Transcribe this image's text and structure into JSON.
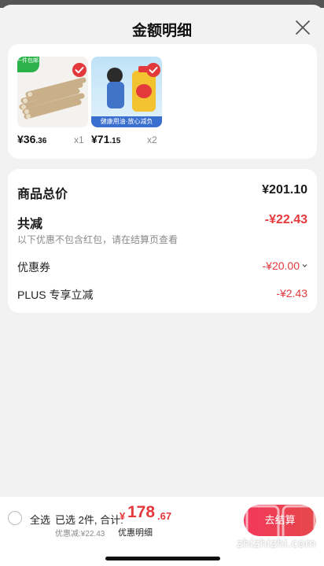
{
  "header": {
    "title": "金额明细"
  },
  "products": [
    {
      "tag": "一件包邮",
      "price_int": "¥36",
      "price_dec": ".36",
      "qty": "x1"
    },
    {
      "tag": "",
      "price_int": "¥71",
      "price_dec": ".15",
      "qty": "x2",
      "banner": "健康用油·放心减负"
    }
  ],
  "summary": {
    "total_label": "商品总价",
    "total_value": "¥201.10",
    "reduce_label": "共减",
    "reduce_value": "-¥22.43",
    "note": "以下优惠不包含红包，请在结算页查看",
    "coupon_label": "优惠券",
    "coupon_value": "-¥20.00",
    "plus_label": "PLUS 专享立减",
    "plus_value": "-¥2.43"
  },
  "bottom": {
    "select_all": "全选",
    "selected_text": "已选 2件, 合计:",
    "sum_currency": "¥",
    "sum_int": "178",
    "sum_dec": ".67",
    "discount_text": "优惠减:¥22.43",
    "detail_link": "优惠明细",
    "checkout_label": "去结算"
  },
  "watermark": {
    "url": "zhizhizhi.com"
  },
  "colors": {
    "accent": "#e4393c",
    "green_tag": "#2bb34a"
  }
}
